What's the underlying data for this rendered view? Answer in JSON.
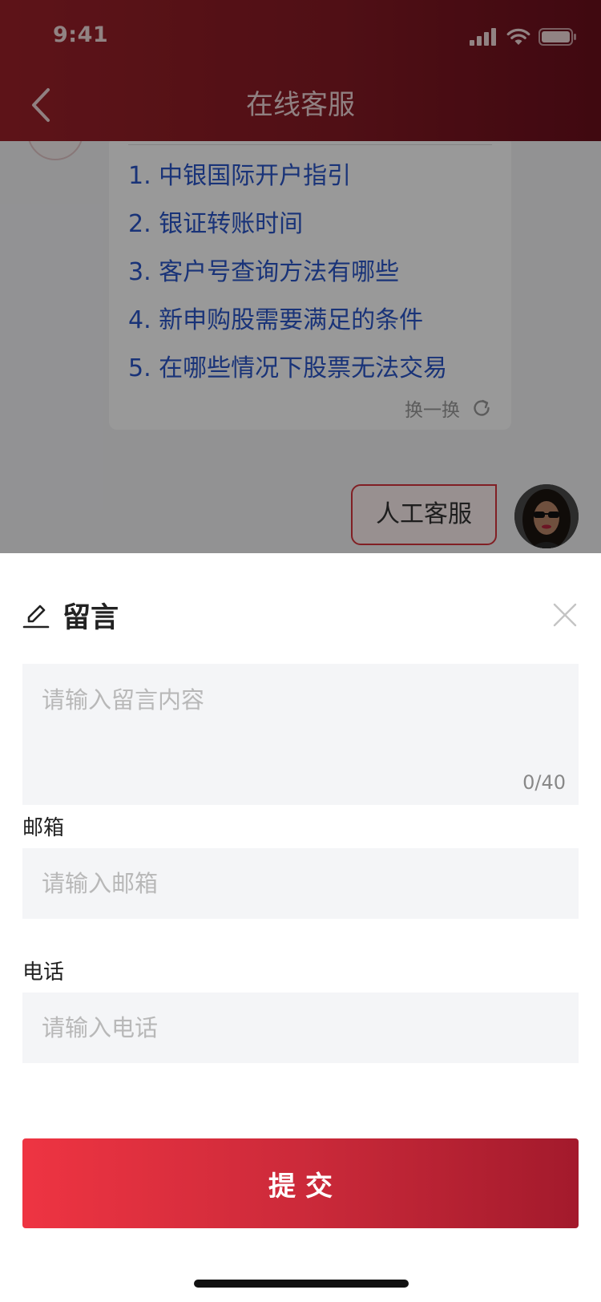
{
  "status_bar": {
    "time": "9:41"
  },
  "header": {
    "title": "在线客服"
  },
  "chat": {
    "faq_items": [
      "1. 中银国际开户指引",
      "2. 银证转账时间",
      "3. 客户号查询方法有哪些",
      "4. 新申购股需要满足的条件",
      "5. 在哪些情况下股票无法交易"
    ],
    "refresh_label": "换一换",
    "user_message": "人工客服"
  },
  "sheet": {
    "title": "留言",
    "message_placeholder": "请输入留言内容",
    "char_count": "0/40",
    "email_label": "邮箱",
    "email_placeholder": "请输入邮箱",
    "phone_label": "电话",
    "phone_placeholder": "请输入电话",
    "submit_label": "提交"
  },
  "icons": {
    "back": "chevron-left-icon",
    "refresh": "refresh-icon",
    "edit": "pencil-icon",
    "close": "close-icon"
  },
  "colors": {
    "header_start": "#9c2129",
    "header_end": "#6b0f1c",
    "link_blue": "#2a55c8",
    "accent_red": "#d8343d",
    "submit_start": "#ee3442",
    "submit_end": "#a31a2c"
  }
}
